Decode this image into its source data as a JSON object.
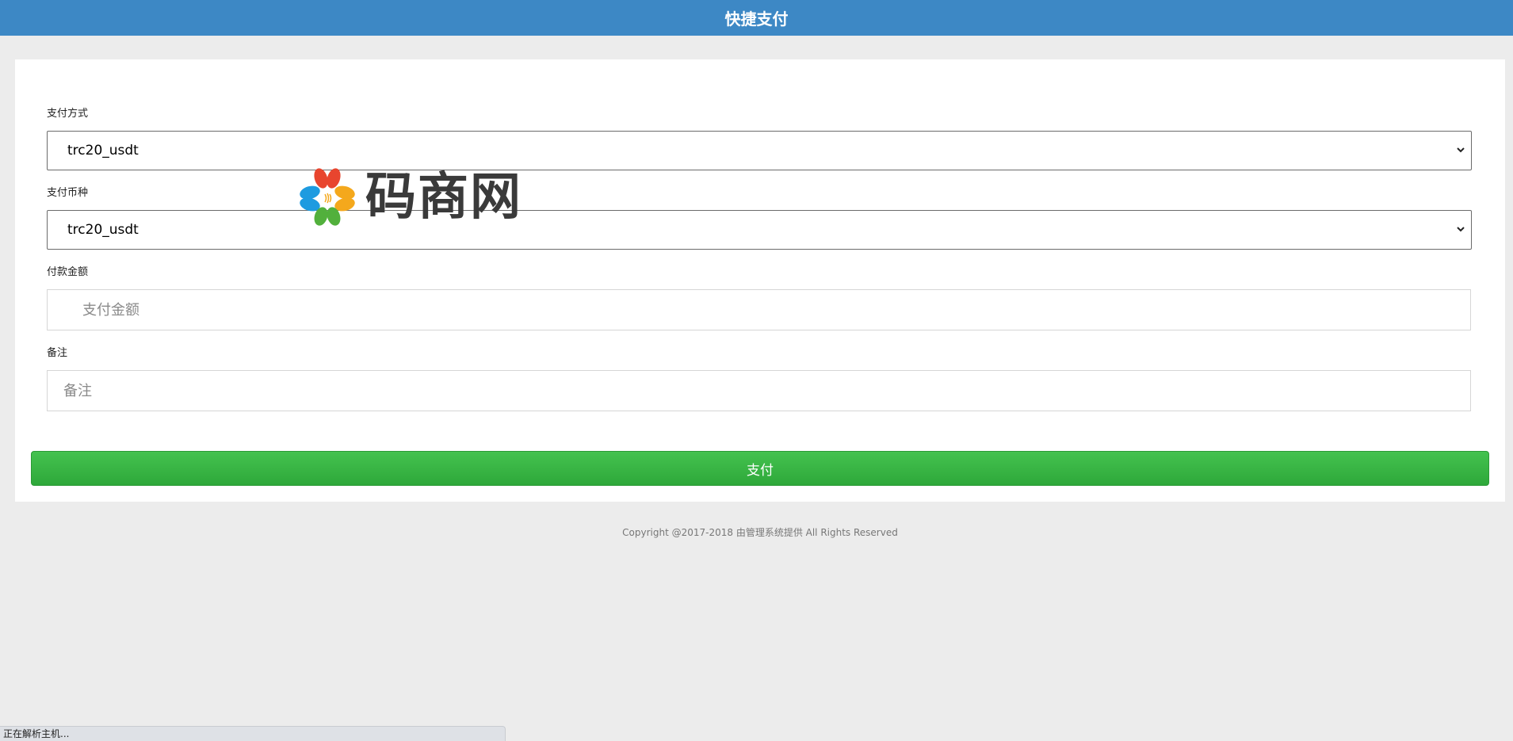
{
  "header": {
    "title": "快捷支付"
  },
  "form": {
    "payment_method": {
      "label": "支付方式",
      "value": "trc20_usdt"
    },
    "currency": {
      "label": "支付币种",
      "value": "trc20_usdt"
    },
    "amount": {
      "label": "付款金额",
      "placeholder": "支付金额"
    },
    "remark": {
      "label": "备注",
      "placeholder": "备注"
    },
    "submit_label": "支付"
  },
  "footer": {
    "text": "Copyright @2017-2018 由管理系统提供 All Rights Reserved"
  },
  "watermark": {
    "text": "码商网"
  },
  "status_bar": {
    "text": "正在解析主机..."
  },
  "colors": {
    "header": "#3d88c5",
    "button": "#3cb846",
    "page_background": "#ececec",
    "card_background": "#ffffff"
  },
  "icons": {
    "select_arrow": "chevron-down-icon",
    "logo": "flower-logo-icon"
  }
}
